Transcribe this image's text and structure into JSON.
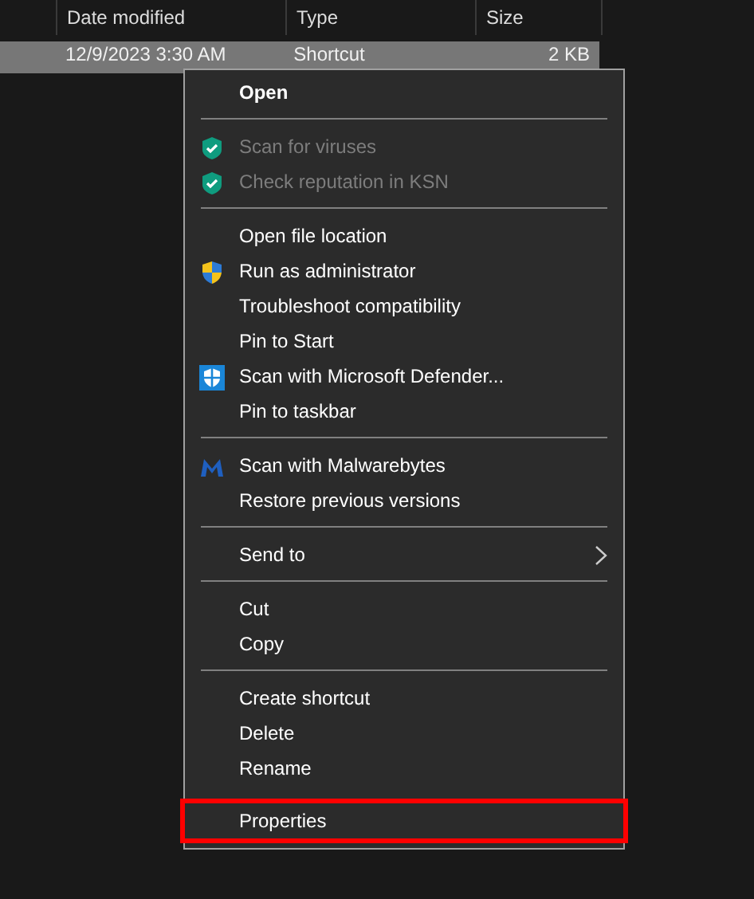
{
  "columns": [
    "Date modified",
    "Type",
    "Size"
  ],
  "row": {
    "cells": [
      "12/9/2023 3:30 AM",
      "Shortcut",
      "2 KB"
    ],
    "selected": true
  },
  "menu": {
    "groups": [
      {
        "items": [
          {
            "label": "Open",
            "bold": true,
            "disabled": false,
            "kind": "plain"
          }
        ]
      },
      {
        "items": [
          {
            "label": "Scan for viruses",
            "disabled": true,
            "kind": "shield-check"
          },
          {
            "label": "Check reputation in KSN",
            "disabled": true,
            "kind": "shield-check"
          }
        ]
      },
      {
        "items": [
          {
            "label": "Open file location",
            "disabled": false,
            "kind": "plain"
          },
          {
            "label": "Run as administrator",
            "disabled": false,
            "kind": "shield"
          },
          {
            "label": "Troubleshoot compatibility",
            "disabled": false,
            "kind": "plain"
          },
          {
            "label": "Pin to Start",
            "disabled": false,
            "kind": "plain"
          },
          {
            "label": "Scan with Microsoft Defender...",
            "disabled": false,
            "kind": "square-shield"
          },
          {
            "label": "Pin to taskbar",
            "disabled": false,
            "kind": "plain"
          }
        ]
      },
      {
        "items": [
          {
            "label": "Scan with Malwarebytes",
            "disabled": false,
            "kind": "m-logo"
          },
          {
            "label": "Restore previous versions",
            "disabled": false,
            "kind": "plain"
          }
        ]
      },
      {
        "items": [
          {
            "label": "Send to",
            "disabled": false,
            "kind": "plain",
            "submenu": true
          }
        ]
      },
      {
        "items": [
          {
            "label": "Cut",
            "disabled": false,
            "kind": "plain"
          },
          {
            "label": "Copy",
            "disabled": false,
            "kind": "plain"
          }
        ]
      },
      {
        "items": [
          {
            "label": "Create shortcut",
            "disabled": false,
            "kind": "plain"
          },
          {
            "label": "Delete",
            "disabled": false,
            "kind": "plain"
          },
          {
            "label": "Rename",
            "disabled": false,
            "kind": "plain"
          },
          {
            "label": "Properties",
            "disabled": false,
            "kind": "plain",
            "highlighted": true
          }
        ]
      }
    ]
  }
}
